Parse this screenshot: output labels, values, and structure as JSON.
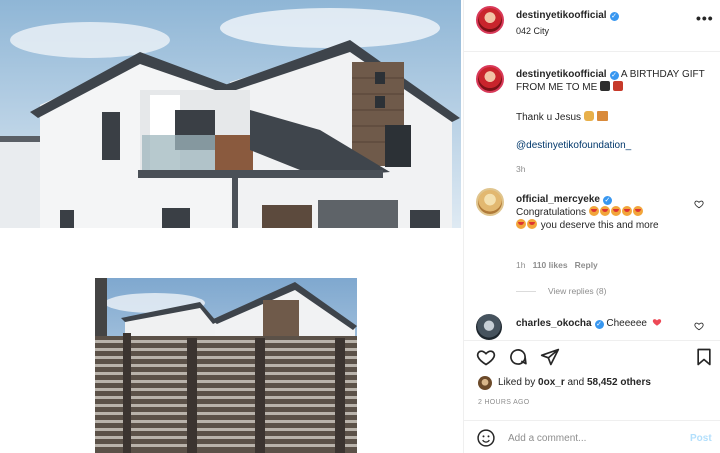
{
  "post": {
    "username": "destinyetikoofficial",
    "location": "042 City",
    "more_label": "•••",
    "caption_username": "destinyetikoofficial",
    "caption_text": "A BIRTHDAY GIFT FROM ME TO ME",
    "caption_line2": "Thank u Jesus",
    "caption_mention": "@destinyetikofoundation_",
    "caption_time": "3h"
  },
  "comments": [
    {
      "username": "official_mercyeke",
      "text_a": "Congratulations",
      "text_b": "you deserve this and more",
      "time": "1h",
      "likes": "110 likes",
      "reply_label": "Reply",
      "view_replies": "View replies (8)"
    },
    {
      "username": "charles_okocha",
      "text": "Cheeeee"
    }
  ],
  "engagement": {
    "liked_by_prefix": "Liked by",
    "liked_by_user": "0ox_r",
    "liked_by_and": "and",
    "likes_count": "58,452 others",
    "time_ago": "2 HOURS AGO"
  },
  "composer": {
    "placeholder": "Add a comment...",
    "post_label": "Post"
  },
  "icons": {
    "verified": "verified-badge-icon",
    "like": "heart-icon",
    "comment": "comment-icon",
    "share": "paper-plane-icon",
    "save": "bookmark-icon",
    "emoji": "smiley-icon"
  },
  "colors": {
    "verified_blue": "#3897f0",
    "link": "#00376b",
    "muted": "#8e8e8e",
    "heart_red": "#ed4956",
    "post_disabled": "#b2dffc"
  }
}
